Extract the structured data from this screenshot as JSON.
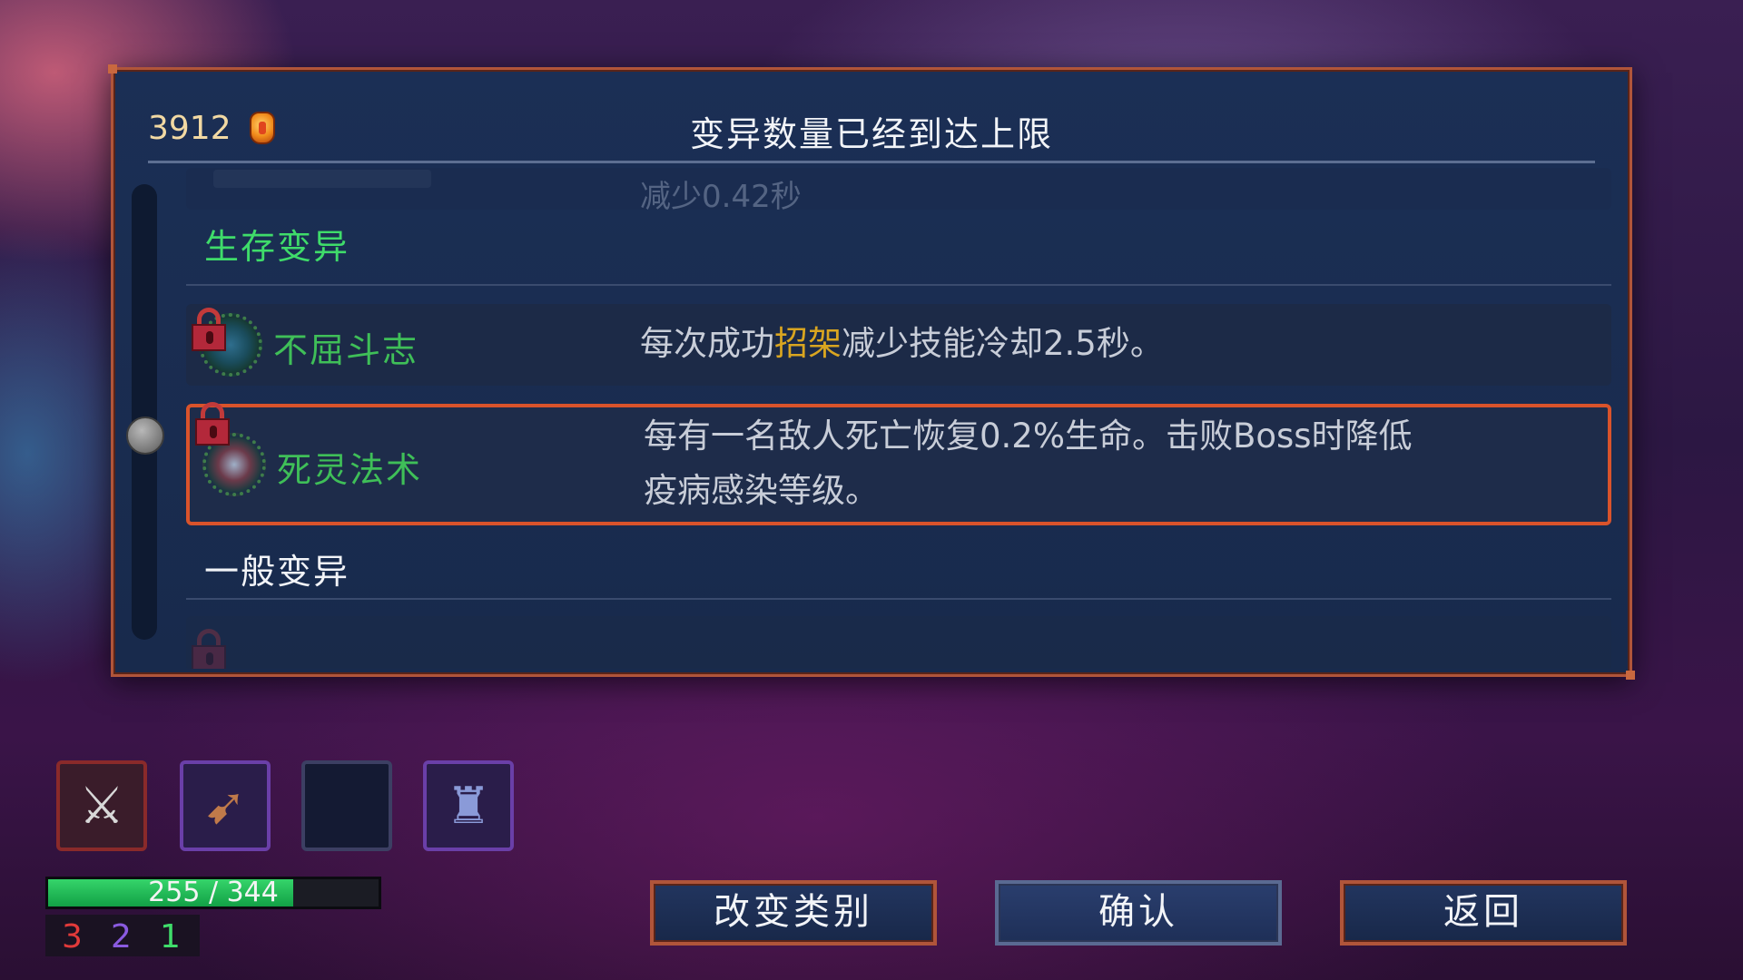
{
  "header": {
    "gold_amount": "3912",
    "title": "变异数量已经到达上限"
  },
  "list": {
    "faded_row_desc": "减少0.42秒",
    "survival_section": "生存变异",
    "survival_color": "#3fdc6a",
    "rows": [
      {
        "name": "不屈斗志",
        "desc_before": "每次成功",
        "desc_highlight": "招架",
        "desc_after": "减少技能冷却2.5秒。",
        "icon": "shield-mutation-icon",
        "locked": true
      },
      {
        "name": "死灵法术",
        "desc_line1": "每有一名敌人死亡恢复0.2%生命。击败Boss时降低",
        "desc_line2": "疫病感染等级。",
        "icon": "skull-mutation-icon",
        "locked": true,
        "selected": true
      }
    ],
    "general_section": "一般变异"
  },
  "hud": {
    "slots": [
      "crossed-swords-icon",
      "bow-icon",
      "empty-slot",
      "turret-icon"
    ],
    "hp_text": "255 / 344",
    "hp_current": 255,
    "hp_max": 344,
    "stat_red": "3",
    "stat_purple": "2",
    "stat_green": "1"
  },
  "buttons": {
    "change_category": "改变类别",
    "confirm": "确认",
    "back": "返回"
  },
  "colors": {
    "accent_border": "#b0553a",
    "selected_border": "#d9532b",
    "mutation_name": "#3fbf58",
    "highlight": "#d9a520"
  }
}
